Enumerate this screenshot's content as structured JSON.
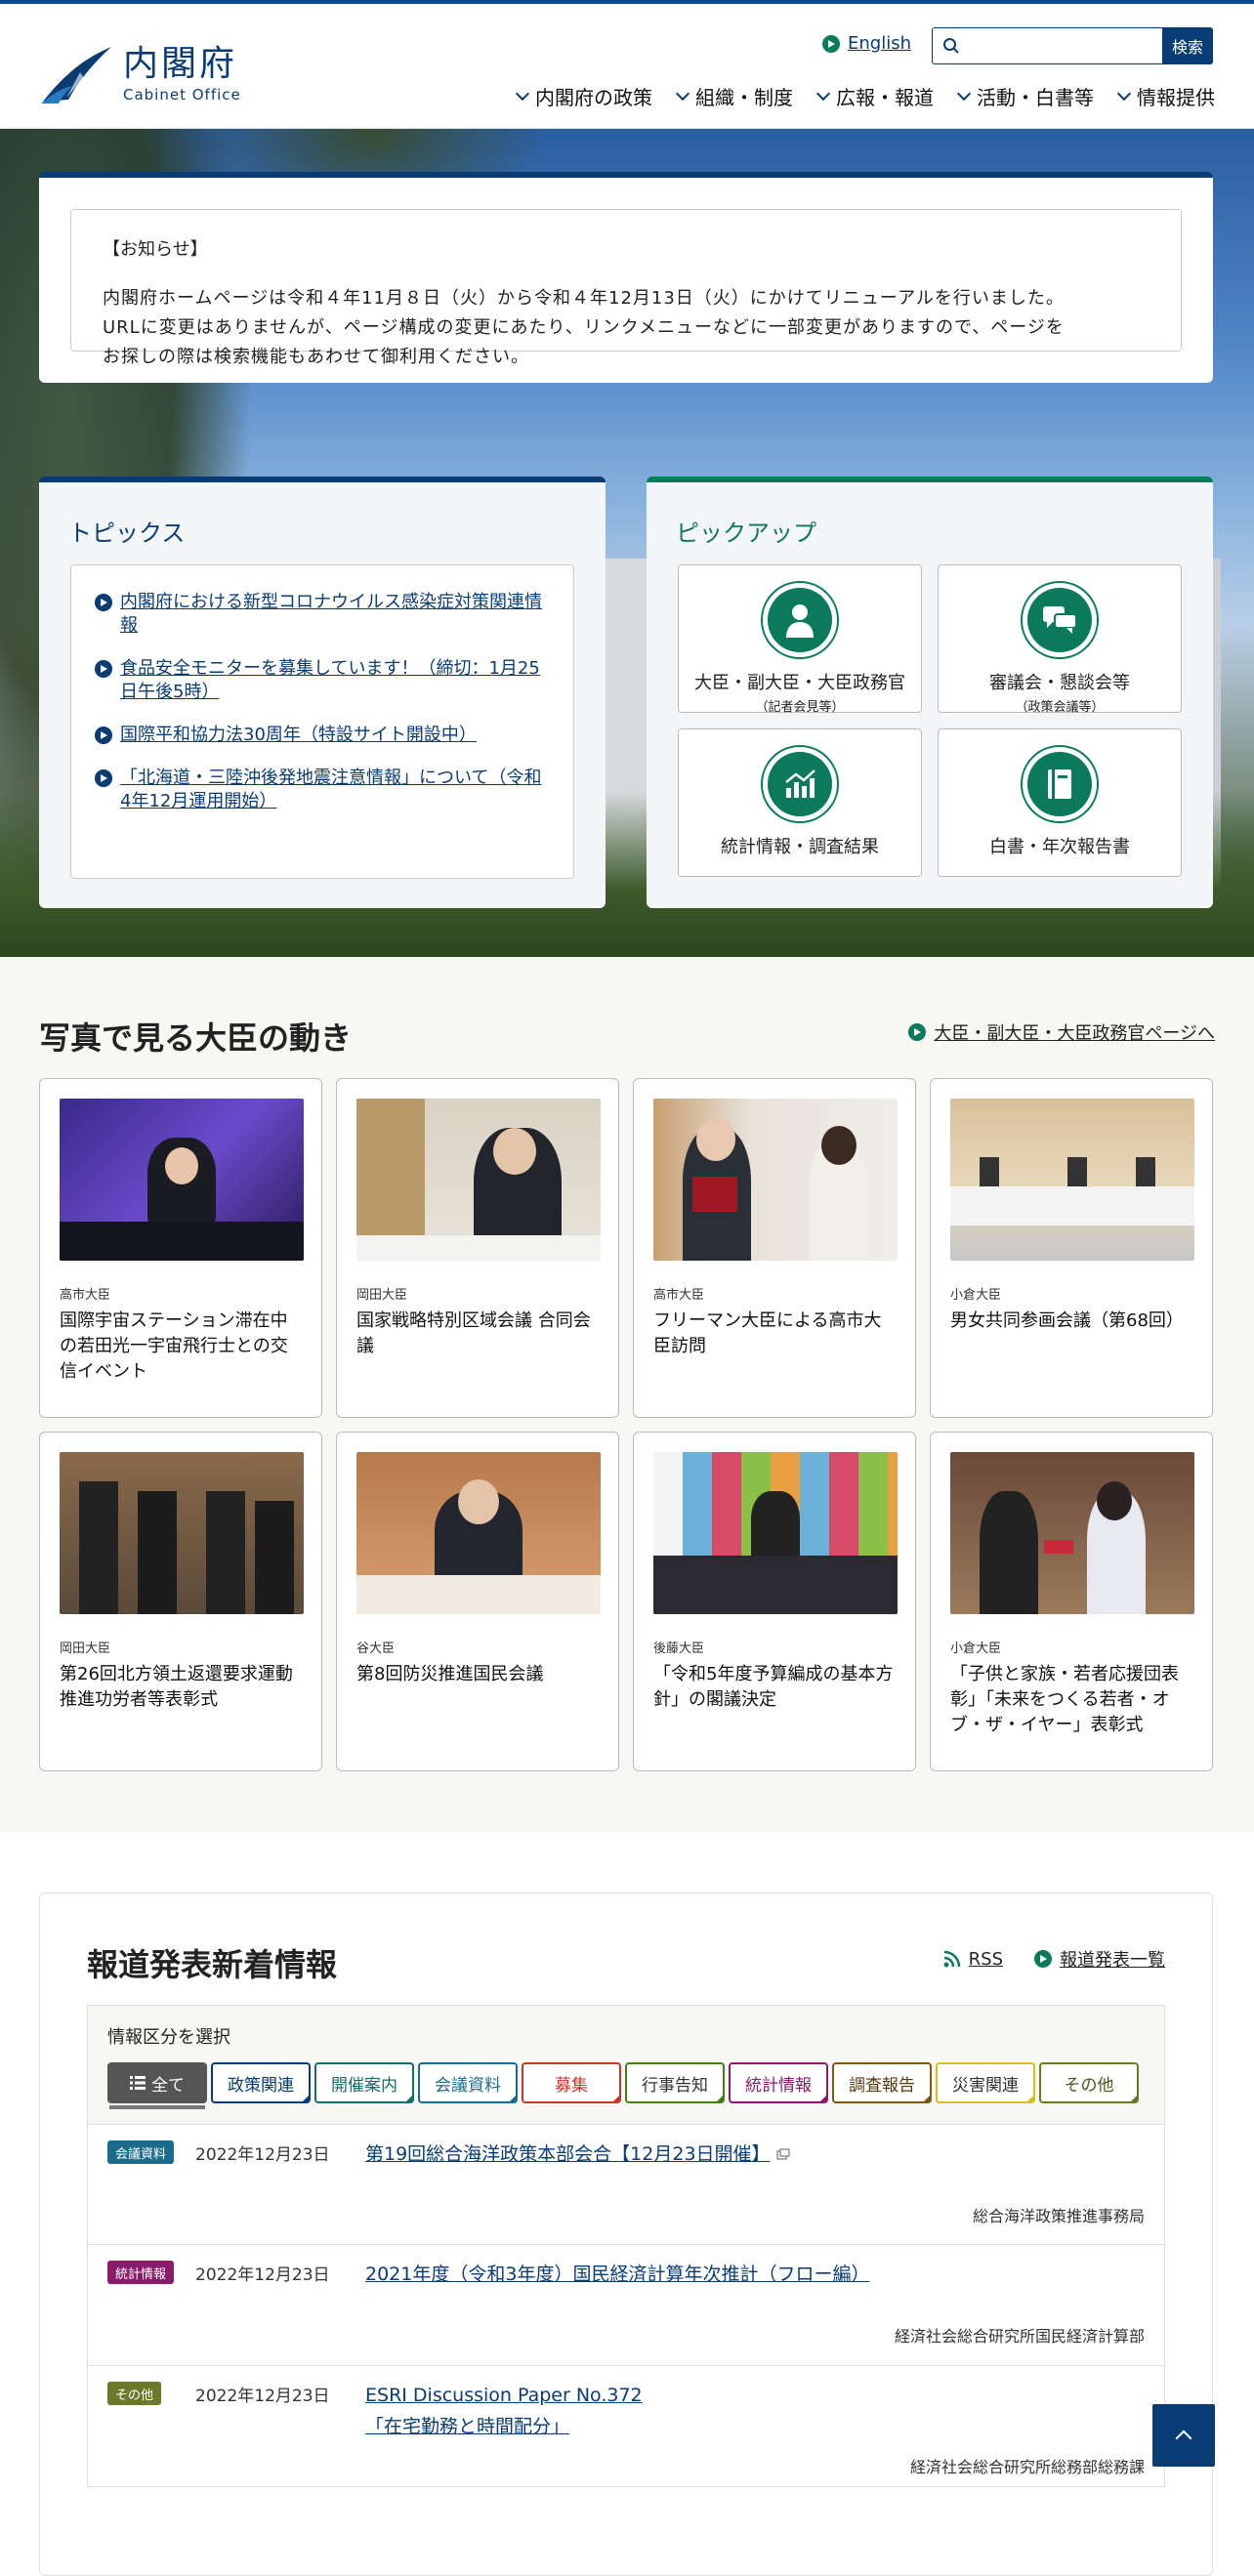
{
  "header": {
    "logo_jp": "内閣府",
    "logo_en": "Cabinet Office",
    "lang_link": "English",
    "search_placeholder": "",
    "search_button": "検索",
    "nav": [
      "内閣府の政策",
      "組織・制度",
      "広報・報道",
      "活動・白書等",
      "情報提供"
    ]
  },
  "notice": {
    "title": "【お知らせ】",
    "lines": [
      "内閣府ホームページは令和４年11月８日（火）から令和４年12月13日（火）にかけてリニューアルを行いました。",
      "URLに変更はありませんが、ページ構成の変更にあたり、リンクメニューなどに一部変更がありますので、ページを",
      "お探しの際は検索機能もあわせて御利用ください。"
    ]
  },
  "topics": {
    "title": "トピックス",
    "items": [
      "内閣府における新型コロナウイルス感染症対策関連情報",
      "食品安全モニターを募集しています！（締切：1月25日午後5時）",
      "国際平和協力法30周年（特設サイト開設中）",
      "「北海道・三陸沖後発地震注意情報」について（令和4年12月運用開始）"
    ]
  },
  "pickup": {
    "title": "ピックアップ",
    "items": [
      {
        "label": "大臣・副大臣・大臣政務官",
        "sub": "（記者会見等）",
        "icon": "person-icon"
      },
      {
        "label": "審議会・懇談会等",
        "sub": "（政策会議等）",
        "icon": "chat-icon"
      },
      {
        "label": "統計情報・調査結果",
        "sub": "",
        "icon": "chart-icon"
      },
      {
        "label": "白書・年次報告書",
        "sub": "",
        "icon": "book-icon"
      }
    ]
  },
  "photos": {
    "title": "写真で見る大臣の動き",
    "link": "大臣・副大臣・大臣政務官ページへ",
    "cards": [
      {
        "who": "高市大臣",
        "title": "国際宇宙ステーション滞在中の若田光一宇宙飛行士との交信イベント"
      },
      {
        "who": "岡田大臣",
        "title": "国家戦略特別区域会議 合同会議"
      },
      {
        "who": "高市大臣",
        "title": "フリーマン大臣による高市大臣訪問"
      },
      {
        "who": "小倉大臣",
        "title": "男女共同参画会議（第68回）"
      },
      {
        "who": "岡田大臣",
        "title": "第26回北方領土返還要求運動推進功労者等表彰式"
      },
      {
        "who": "谷大臣",
        "title": "第8回防災推進国民会議"
      },
      {
        "who": "後藤大臣",
        "title": "「令和5年度予算編成の基本方針」の閣議決定"
      },
      {
        "who": "小倉大臣",
        "title": "「子供と家族・若者応援団表彰」「未来をつくる若者・オブ・ザ・イヤー」表彰式"
      }
    ]
  },
  "press": {
    "title": "報道発表新着情報",
    "rss": "RSS",
    "list_link": "報道発表一覧",
    "filter_title": "情報区分を選択",
    "filters": [
      {
        "label": "全て",
        "color": "#555555"
      },
      {
        "label": "政策関連",
        "color": "#0a3c74"
      },
      {
        "label": "開催案内",
        "color": "#1b6b6b"
      },
      {
        "label": "会議資料",
        "color": "#1b6b8b"
      },
      {
        "label": "募集",
        "color": "#c0392b"
      },
      {
        "label": "行事告知",
        "color": "#4a7a1a"
      },
      {
        "label": "統計情報",
        "color": "#8b1a6b"
      },
      {
        "label": "調査報告",
        "color": "#7a5a1a"
      },
      {
        "label": "災害関連",
        "color": "#d4c21a"
      },
      {
        "label": "その他",
        "color": "#6b7a2a"
      }
    ],
    "items": [
      {
        "tag": "会議資料",
        "tag_color": "#1b6b8b",
        "date": "2022年12月23日",
        "title": "第19回総合海洋政策本部会合【12月23日開催】",
        "title2": "",
        "external": true,
        "bureau": "総合海洋政策推進事務局"
      },
      {
        "tag": "統計情報",
        "tag_color": "#8b1a6b",
        "date": "2022年12月23日",
        "title": "2021年度（令和3年度）国民経済計算年次推計（フロー編）",
        "title2": "",
        "external": false,
        "bureau": "経済社会総合研究所国民経済計算部"
      },
      {
        "tag": "その他",
        "tag_color": "#6b7a2a",
        "date": "2022年12月23日",
        "title": "ESRI Discussion Paper No.372",
        "title2": "「在宅勤務と時間配分」",
        "external": false,
        "bureau": "経済社会総合研究所総務部総務課"
      }
    ]
  }
}
